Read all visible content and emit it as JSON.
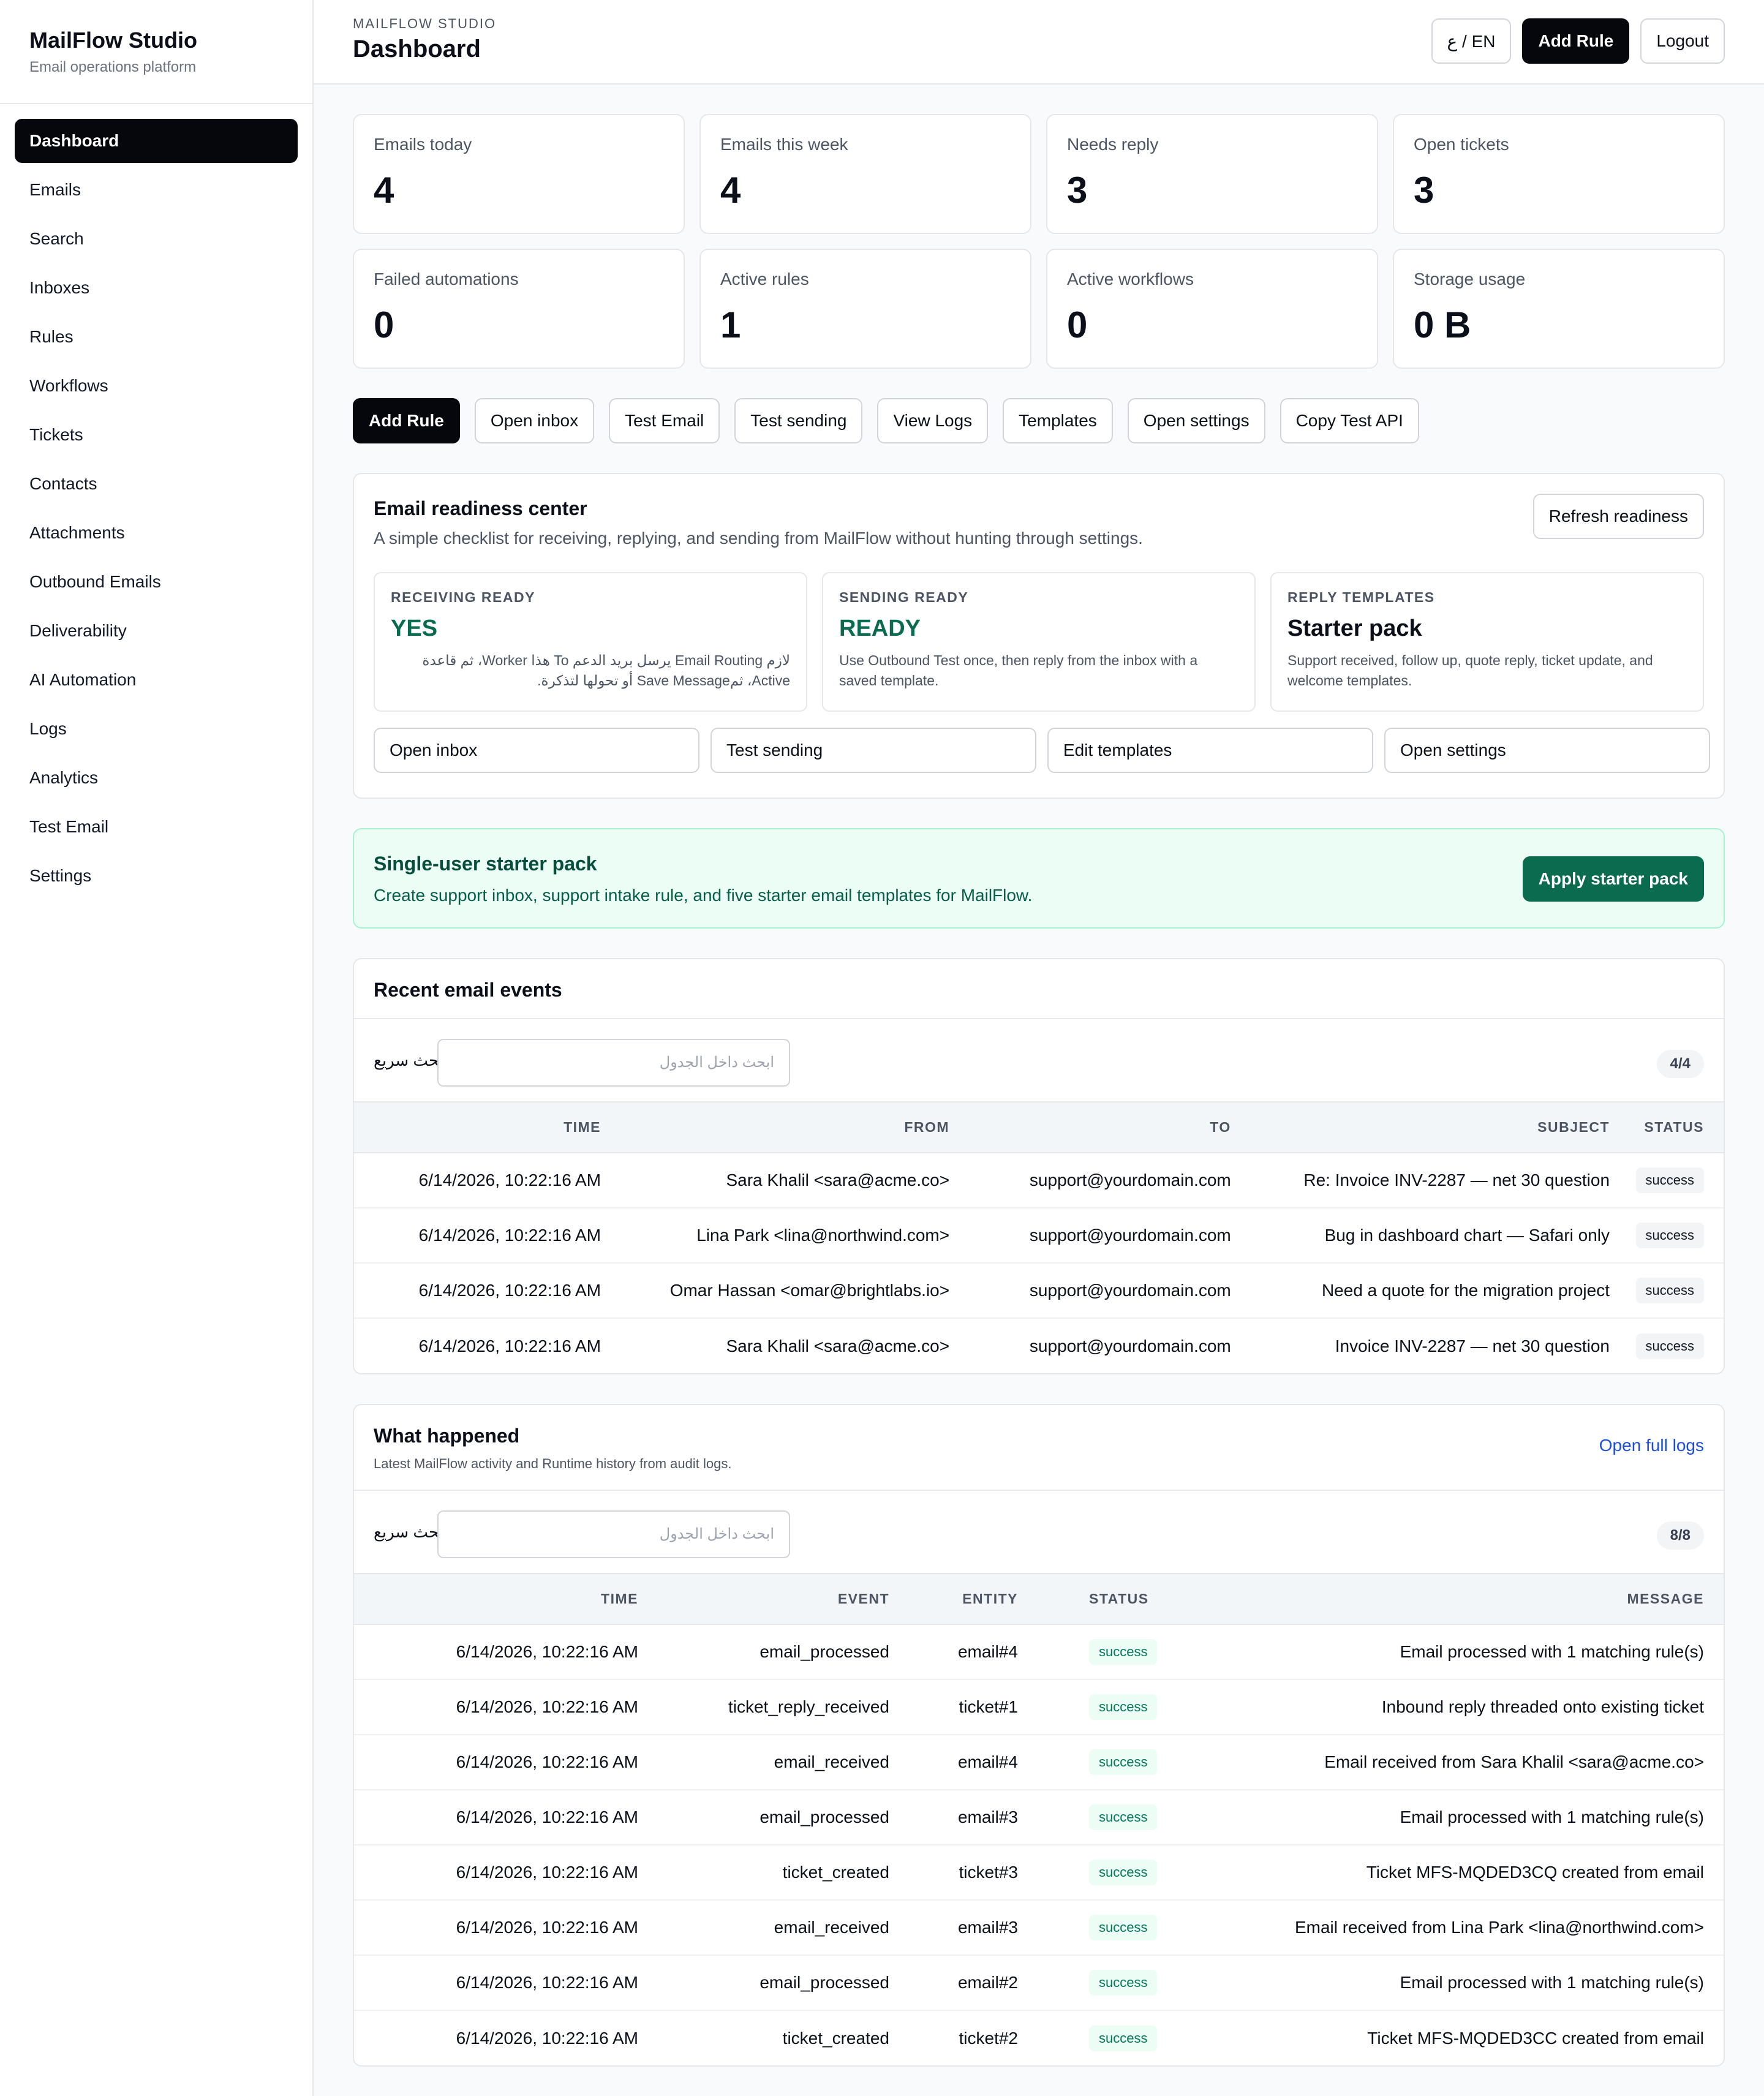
{
  "sidebar": {
    "brand_title": "MailFlow Studio",
    "brand_sub": "Email operations platform",
    "items": [
      "Dashboard",
      "Emails",
      "Search",
      "Inboxes",
      "Rules",
      "Workflows",
      "Tickets",
      "Contacts",
      "Attachments",
      "Outbound Emails",
      "Deliverability",
      "AI Automation",
      "Logs",
      "Analytics",
      "Test Email",
      "Settings"
    ]
  },
  "header": {
    "kicker": "MAILFLOW STUDIO",
    "title": "Dashboard",
    "lang": "ع / EN",
    "add_rule": "Add Rule",
    "logout": "Logout"
  },
  "stats": [
    {
      "label": "Emails today",
      "value": "4"
    },
    {
      "label": "Emails this week",
      "value": "4"
    },
    {
      "label": "Needs reply",
      "value": "3"
    },
    {
      "label": "Open tickets",
      "value": "3"
    },
    {
      "label": "Failed automations",
      "value": "0"
    },
    {
      "label": "Active rules",
      "value": "1"
    },
    {
      "label": "Active workflows",
      "value": "0"
    },
    {
      "label": "Storage usage",
      "value": "0 B"
    }
  ],
  "quick_actions": [
    "Add Rule",
    "Open inbox",
    "Test Email",
    "Test sending",
    "View Logs",
    "Templates",
    "Open settings",
    "Copy Test API"
  ],
  "readiness": {
    "title": "Email readiness center",
    "desc": "A simple checklist for receiving, replying, and sending from MailFlow without hunting through settings.",
    "refresh": "Refresh readiness",
    "boxes": [
      {
        "kicker": "RECEIVING READY",
        "status": "YES",
        "note": "لازم Email Routing يرسل بريد الدعم To هذا Worker، ثم قاعدة Active، ثمSave Message أو تحولها لتذكرة."
      },
      {
        "kicker": "SENDING READY",
        "status": "READY",
        "note": "Use Outbound Test once, then reply from the inbox with a saved template."
      },
      {
        "kicker": "REPLY TEMPLATES",
        "status": "Starter pack",
        "note": "Support received, follow up, quote reply, ticket update, and welcome templates."
      }
    ],
    "links": [
      "Open inbox",
      "Test sending",
      "Edit templates",
      "Open settings"
    ]
  },
  "starter": {
    "title": "Single-user starter pack",
    "desc": "Create support inbox, support intake rule, and five starter email templates for MailFlow.",
    "button": "Apply starter pack"
  },
  "recent": {
    "title": "Recent email events",
    "filter_label": "بحث سريع",
    "placeholder": "ابحث داخل الجدول",
    "count": "4/4",
    "columns": [
      "TIME",
      "FROM",
      "TO",
      "SUBJECT",
      "STATUS"
    ],
    "rows": [
      [
        "6/14/2026, 10:22:16 AM",
        "Sara Khalil <sara@acme.co>",
        "support@yourdomain.com",
        "Re: Invoice INV-2287 — net 30 question",
        "success"
      ],
      [
        "6/14/2026, 10:22:16 AM",
        "Lina Park <lina@northwind.com>",
        "support@yourdomain.com",
        "Bug in dashboard chart — Safari only",
        "success"
      ],
      [
        "6/14/2026, 10:22:16 AM",
        "Omar Hassan <omar@brightlabs.io>",
        "support@yourdomain.com",
        "Need a quote for the migration project",
        "success"
      ],
      [
        "6/14/2026, 10:22:16 AM",
        "Sara Khalil <sara@acme.co>",
        "support@yourdomain.com",
        "Invoice INV-2287 — net 30 question",
        "success"
      ]
    ]
  },
  "happened": {
    "title": "What happened",
    "sub": "Latest MailFlow activity and Runtime history from audit logs.",
    "link": "Open full logs",
    "filter_label": "بحث سريع",
    "placeholder": "ابحث داخل الجدول",
    "count": "8/8",
    "columns": [
      "TIME",
      "EVENT",
      "ENTITY",
      "STATUS",
      "MESSAGE"
    ],
    "rows": [
      [
        "6/14/2026, 10:22:16 AM",
        "email_processed",
        "email#4",
        "success",
        "Email processed with 1 matching rule(s)"
      ],
      [
        "6/14/2026, 10:22:16 AM",
        "ticket_reply_received",
        "ticket#1",
        "success",
        "Inbound reply threaded onto existing ticket"
      ],
      [
        "6/14/2026, 10:22:16 AM",
        "email_received",
        "email#4",
        "success",
        "Email received from Sara Khalil <sara@acme.co>"
      ],
      [
        "6/14/2026, 10:22:16 AM",
        "email_processed",
        "email#3",
        "success",
        "Email processed with 1 matching rule(s)"
      ],
      [
        "6/14/2026, 10:22:16 AM",
        "ticket_created",
        "ticket#3",
        "success",
        "Ticket MFS-MQDED3CQ created from email"
      ],
      [
        "6/14/2026, 10:22:16 AM",
        "email_received",
        "email#3",
        "success",
        "Email received from Lina Park <lina@northwind.com>"
      ],
      [
        "6/14/2026, 10:22:16 AM",
        "email_processed",
        "email#2",
        "success",
        "Email processed with 1 matching rule(s)"
      ],
      [
        "6/14/2026, 10:22:16 AM",
        "ticket_created",
        "ticket#2",
        "success",
        "Ticket MFS-MQDED3CC created from email"
      ]
    ]
  }
}
